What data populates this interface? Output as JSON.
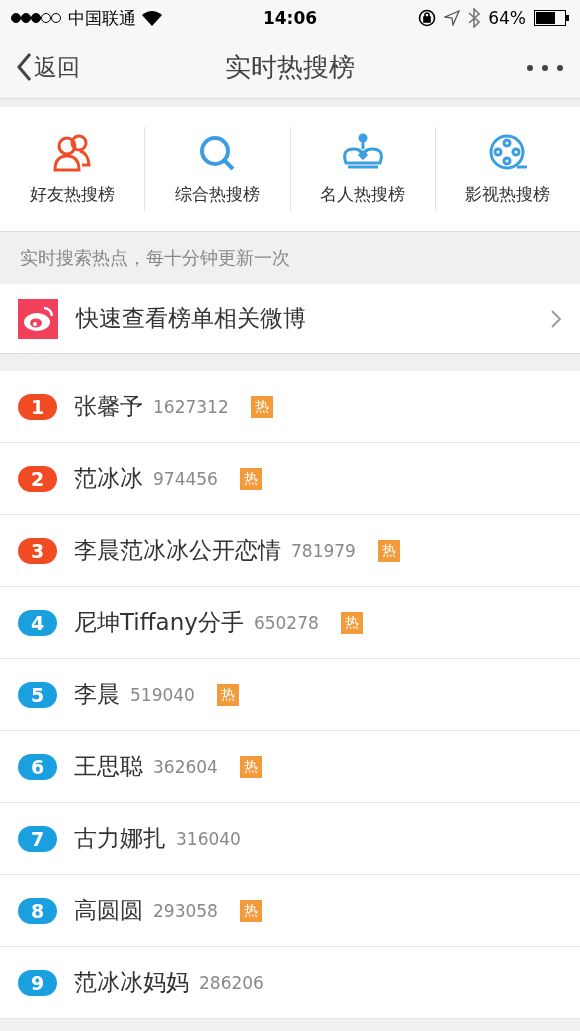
{
  "status_bar": {
    "carrier": "中国联通",
    "time": "14:06",
    "battery": "64%"
  },
  "nav": {
    "back": "返回",
    "title": "实时热搜榜"
  },
  "categories": [
    {
      "label": "好友热搜榜",
      "kind": "friends"
    },
    {
      "label": "综合热搜榜",
      "kind": "search"
    },
    {
      "label": "名人热搜榜",
      "kind": "crown"
    },
    {
      "label": "影视热搜榜",
      "kind": "film"
    }
  ],
  "notice": "实时搜索热点，每十分钟更新一次",
  "quick_link": {
    "label": "快速查看榜单相关微博"
  },
  "rankings": [
    {
      "rank": "1",
      "name": "张馨予",
      "count": "1627312",
      "tag": "热",
      "color": "#f04b23"
    },
    {
      "rank": "2",
      "name": "范冰冰",
      "count": "974456",
      "tag": "热",
      "color": "#f04b23"
    },
    {
      "rank": "3",
      "name": "李晨范冰冰公开恋情",
      "count": "781979",
      "tag": "热",
      "color": "#f04b23"
    },
    {
      "rank": "4",
      "name": "尼坤Tiffany分手",
      "count": "650278",
      "tag": "热",
      "color": "#1aa0e0"
    },
    {
      "rank": "5",
      "name": "李晨",
      "count": "519040",
      "tag": "热",
      "color": "#1aa0e0"
    },
    {
      "rank": "6",
      "name": "王思聪",
      "count": "362604",
      "tag": "热",
      "color": "#1aa0e0"
    },
    {
      "rank": "7",
      "name": "古力娜扎",
      "count": "316040",
      "color": "#1aa0e0"
    },
    {
      "rank": "8",
      "name": "高圆圆",
      "count": "293058",
      "tag": "热",
      "color": "#1aa0e0"
    },
    {
      "rank": "9",
      "name": "范冰冰妈妈",
      "count": "286206",
      "color": "#1aa0e0"
    }
  ]
}
